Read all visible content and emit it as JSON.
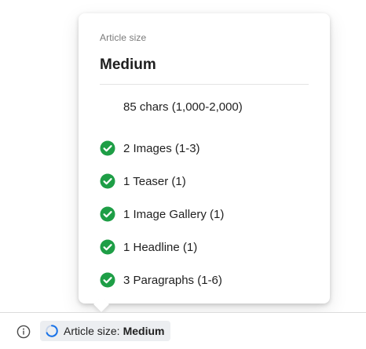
{
  "popover": {
    "label": "Article size",
    "title": "Medium",
    "requirements": [
      {
        "text": "85 chars (1,000-2,000)",
        "status": "unmet",
        "icon": "none"
      },
      {
        "text": "2 Images (1-3)",
        "status": "met",
        "icon": "check-circle-icon"
      },
      {
        "text": "1 Teaser (1)",
        "status": "met",
        "icon": "check-circle-icon"
      },
      {
        "text": "1 Image Gallery (1)",
        "status": "met",
        "icon": "check-circle-icon"
      },
      {
        "text": "1 Headline (1)",
        "status": "met",
        "icon": "check-circle-icon"
      },
      {
        "text": "3 Paragraphs (1-6)",
        "status": "met",
        "icon": "check-circle-icon"
      }
    ]
  },
  "status_bar": {
    "info_icon": "info-icon",
    "chip_label": "Article size:",
    "chip_value": "Medium",
    "chip_icon": "progress-ring-icon"
  },
  "colors": {
    "check": "#1e9e46",
    "spinner": "#1a73e8",
    "chip_bg": "#eceef1"
  }
}
